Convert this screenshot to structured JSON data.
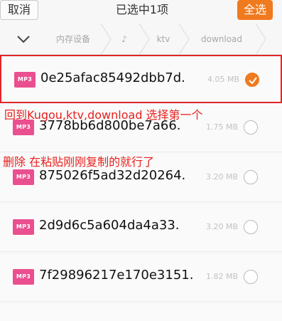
{
  "toolbar": {
    "cancel_label": "取消",
    "title": "已选中1项",
    "select_all_label": "全选"
  },
  "breadcrumb": {
    "items": [
      "内存设备",
      "♪",
      "ktv",
      "download"
    ]
  },
  "files": [
    {
      "name": "0e25afac85492dbb7d.",
      "size": "4.05 MB",
      "selected": true,
      "badge": "MP3"
    },
    {
      "name": "3778bb6d800be7a66.",
      "size": "1.75 MB",
      "selected": false,
      "badge": "MP3"
    },
    {
      "name": "875026f5ad32d20264.",
      "size": "3.20 MB",
      "selected": false,
      "badge": "MP3"
    },
    {
      "name": "2d9d6c5a604da4a33.",
      "size": "3.20 MB",
      "selected": false,
      "badge": "MP3"
    },
    {
      "name": "7f29896217e170e3151.",
      "size": "1.82 MB",
      "selected": false,
      "badge": "MP3"
    }
  ],
  "annotations": {
    "line1": "回到Kugou,ktv,download  选择第一个",
    "line2": "删除   在粘贴刚刚复制的就行了"
  },
  "colors": {
    "accent": "#f07a1e",
    "mp3_badge": "#ea4f8f",
    "annotation": "#e8211f"
  }
}
